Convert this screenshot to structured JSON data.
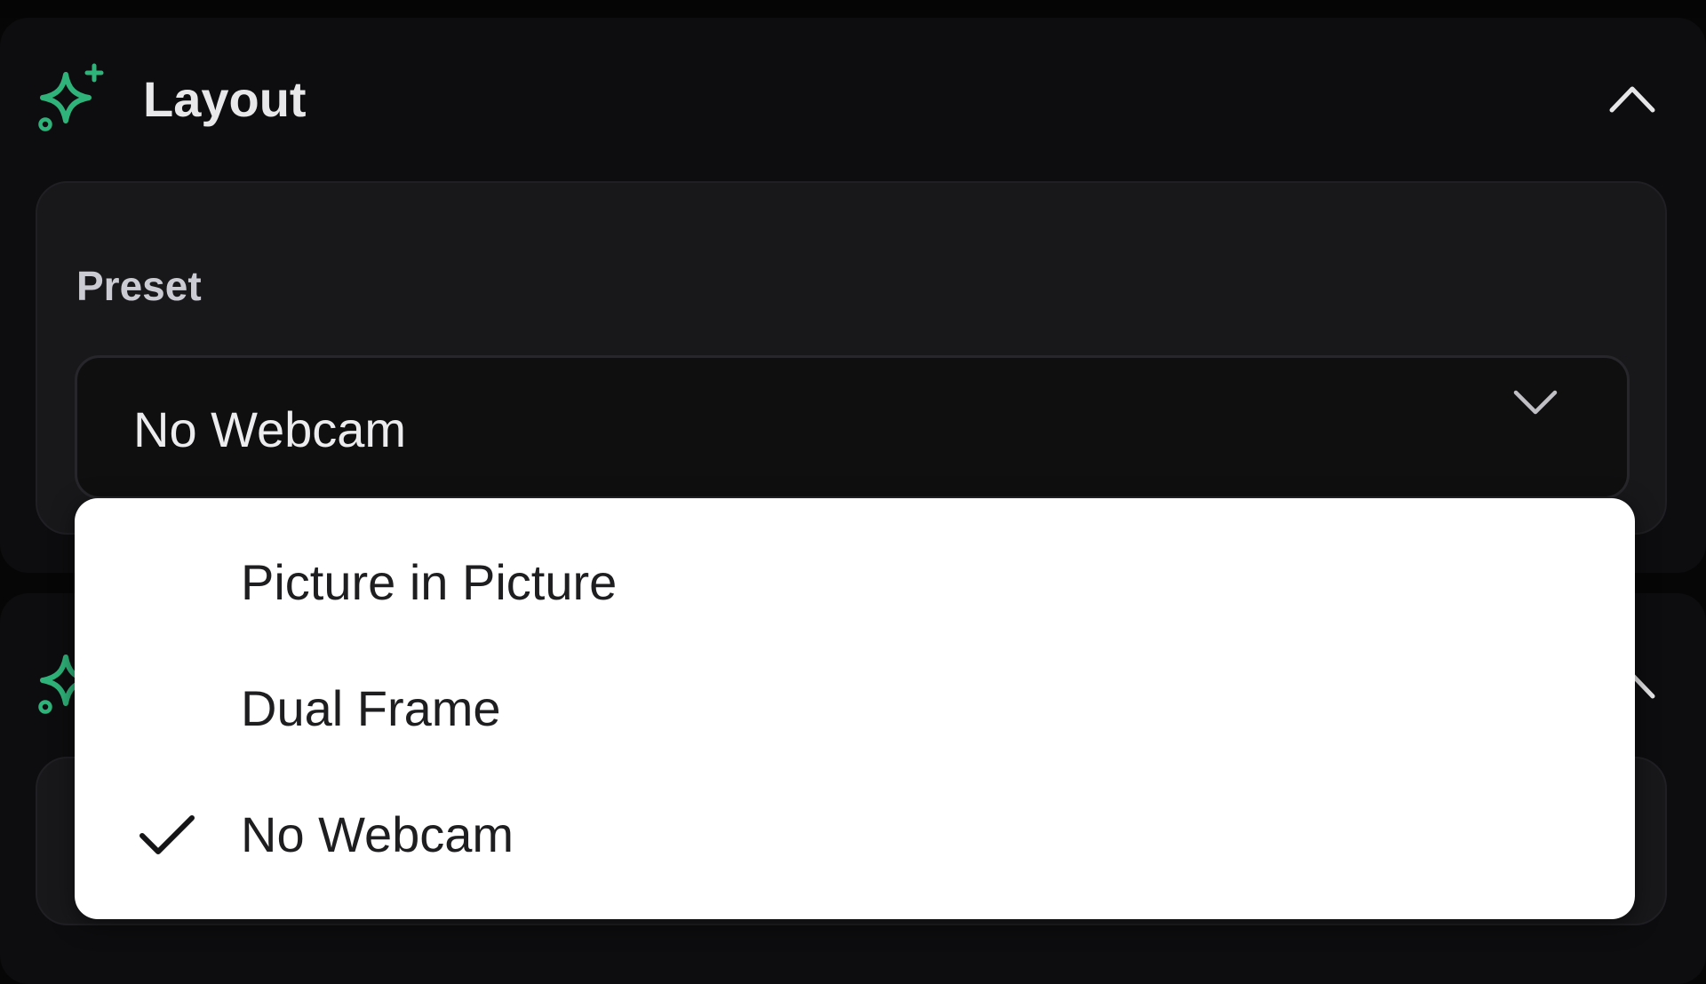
{
  "layout_panel": {
    "title": "Layout",
    "icon": "sparkle-icon",
    "collapse_icon": "chevron-up-icon",
    "accent_color": "#2fb37a"
  },
  "preset_field": {
    "label": "Preset",
    "selected_value": "No Webcam",
    "icon": "chevron-down-icon"
  },
  "dropdown": {
    "options": [
      {
        "label": "Picture in Picture",
        "selected": false
      },
      {
        "label": "Dual Frame",
        "selected": false
      },
      {
        "label": "No Webcam",
        "selected": true
      }
    ],
    "selected_icon": "check-icon"
  },
  "colors": {
    "background": "#060607",
    "panel": "#0d0d0f",
    "card": "#18181b",
    "menu": "#ffffff",
    "text_primary": "#e8e8ea",
    "menu_text": "#1e1e20"
  }
}
